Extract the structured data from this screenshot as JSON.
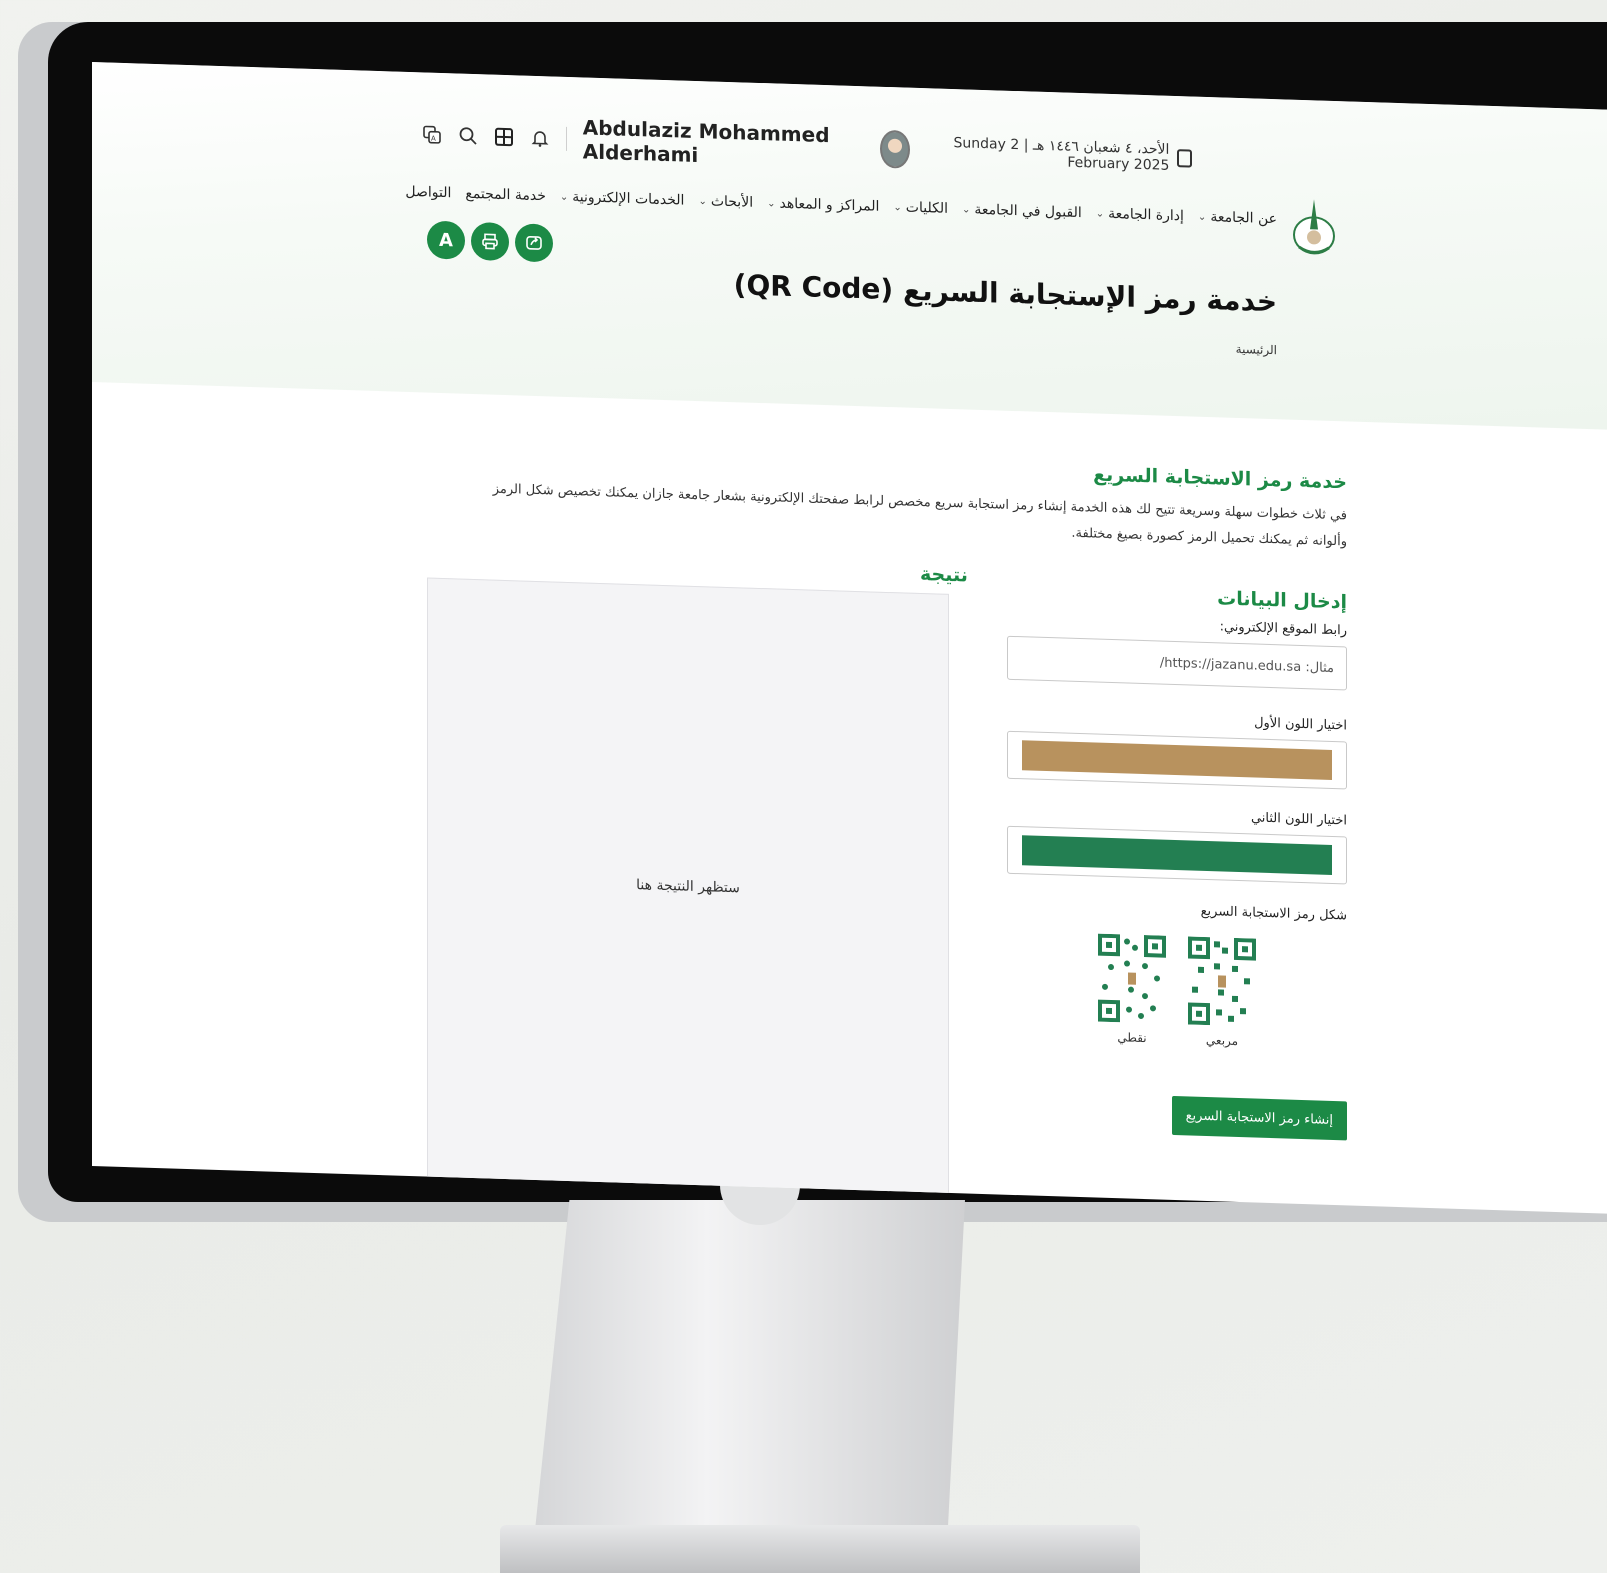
{
  "topbar": {
    "user_name": "Abdulaziz Mohammed Alderhami",
    "date_text": "الأحد، ٤ شعبان ١٤٤٦ هـ | Sunday 2 February 2025",
    "icons": [
      "translate-icon",
      "search-icon",
      "grid-icon",
      "bell-icon"
    ]
  },
  "nav": {
    "items": [
      {
        "label": "عن الجامعة",
        "chevron": true
      },
      {
        "label": "إدارة الجامعة",
        "chevron": true
      },
      {
        "label": "القبول في الجامعة",
        "chevron": true
      },
      {
        "label": "الكليات",
        "chevron": true
      },
      {
        "label": "المراكز و المعاهد",
        "chevron": true
      },
      {
        "label": "الأبحاث",
        "chevron": true
      },
      {
        "label": "الخدمات الإلكترونية",
        "chevron": true
      },
      {
        "label": "خدمة المجتمع",
        "chevron": false
      },
      {
        "label": "التواصل",
        "chevron": false
      }
    ]
  },
  "actions": {
    "font_label": "A"
  },
  "page": {
    "title": "خدمة رمز الإستجابة السريع (QR Code)",
    "breadcrumb": "الرئيسية"
  },
  "intro": {
    "title": "خدمة رمز الاستجابة السريع",
    "text": "في ثلاث خطوات سهلة وسريعة تتيح لك هذه الخدمة إنشاء رمز استجابة سريع مخصص لرابط صفحتك الإلكترونية بشعار جامعة جازان يمكنك تخصيص شكل الرمز وألوانه ثم يمكنك تحميل الرمز كصورة بصيغ مختلفة."
  },
  "form": {
    "section_title": "إدخال البيانات",
    "url_label": "رابط الموقع الإلكتروني:",
    "url_placeholder": "مثال: https://jazanu.edu.sa/",
    "url_value": "",
    "color1_label": "اختيار اللون الأول",
    "color1_value": "#b8925e",
    "color2_label": "اختيار اللون الثاني",
    "color2_value": "#237f52",
    "shape_label": "شكل رمز الاستجابة السريع",
    "shapes": [
      {
        "label": "مربعي"
      },
      {
        "label": "نقطي"
      }
    ],
    "generate_label": "إنشاء رمز الاستجابة السريع"
  },
  "result": {
    "title": "نتيجة",
    "placeholder": "ستظهر النتيجة هنا"
  }
}
